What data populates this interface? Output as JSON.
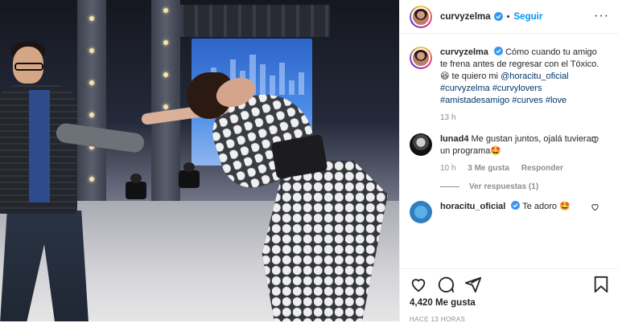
{
  "header": {
    "username": "curvyzelma",
    "separator": "•",
    "follow_label": "Seguir",
    "more": "···"
  },
  "caption": {
    "username": "curvyzelma",
    "text": "Cómo cuando tu amigo te frena antes de regresar con el Tóxico. 😆 te quiero mi",
    "mention": "@horacitu_oficial",
    "hashtags": [
      "#curvyzelma",
      "#curvylovers",
      "#amistadesamigo",
      "#curves",
      "#love"
    ],
    "time": "13 h"
  },
  "comments": [
    {
      "username": "lunad4",
      "text": "Me gustan juntos, ojalá tuvieran un programa🤩",
      "time": "10 h",
      "likes": "3 Me gusta",
      "reply_label": "Responder",
      "view_replies": "Ver respuestas (1)"
    },
    {
      "username": "horacitu_oficial",
      "text": "Te adoro 🤩"
    }
  ],
  "actions": {
    "likes": "4,420 Me gusta",
    "posted_ago": "HACE 13 HORAS"
  },
  "colors": {
    "accent": "#0095f6",
    "verified": "#3897f0",
    "hashtag": "#00376b",
    "muted": "#8e8e8e"
  }
}
